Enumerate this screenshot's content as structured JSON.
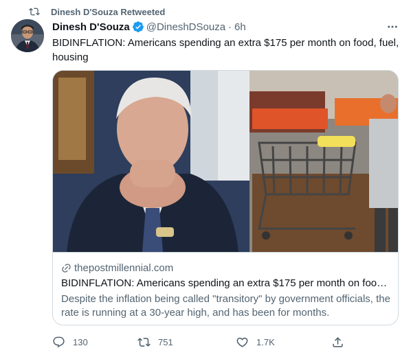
{
  "retweet_header": {
    "text": "Dinesh D'Souza Retweeted"
  },
  "tweet": {
    "display_name": "Dinesh D'Souza",
    "handle": "@DineshDSouza",
    "separator": "·",
    "time": "6h",
    "text": "BIDINFLATION: Americans spending an extra $175 per month on food, fuel, housing"
  },
  "card": {
    "domain": "thepostmillennial.com",
    "title": "BIDINFLATION: Americans spending an extra $175 per month on food,...",
    "description": "Despite the inflation being called \"transitory\" by government officials, the rate is running at a 30-year high, and has been for months."
  },
  "actions": {
    "replies": "130",
    "retweets": "751",
    "likes": "1.7K"
  },
  "colors": {
    "text_primary": "#0f1419",
    "text_secondary": "#536471",
    "verified_blue": "#1d9bf0",
    "border": "#cfd9de"
  },
  "icons": [
    "retweet-icon",
    "verified-badge-icon",
    "more-icon",
    "link-icon",
    "reply-icon",
    "retweet-icon",
    "like-icon",
    "share-icon"
  ]
}
